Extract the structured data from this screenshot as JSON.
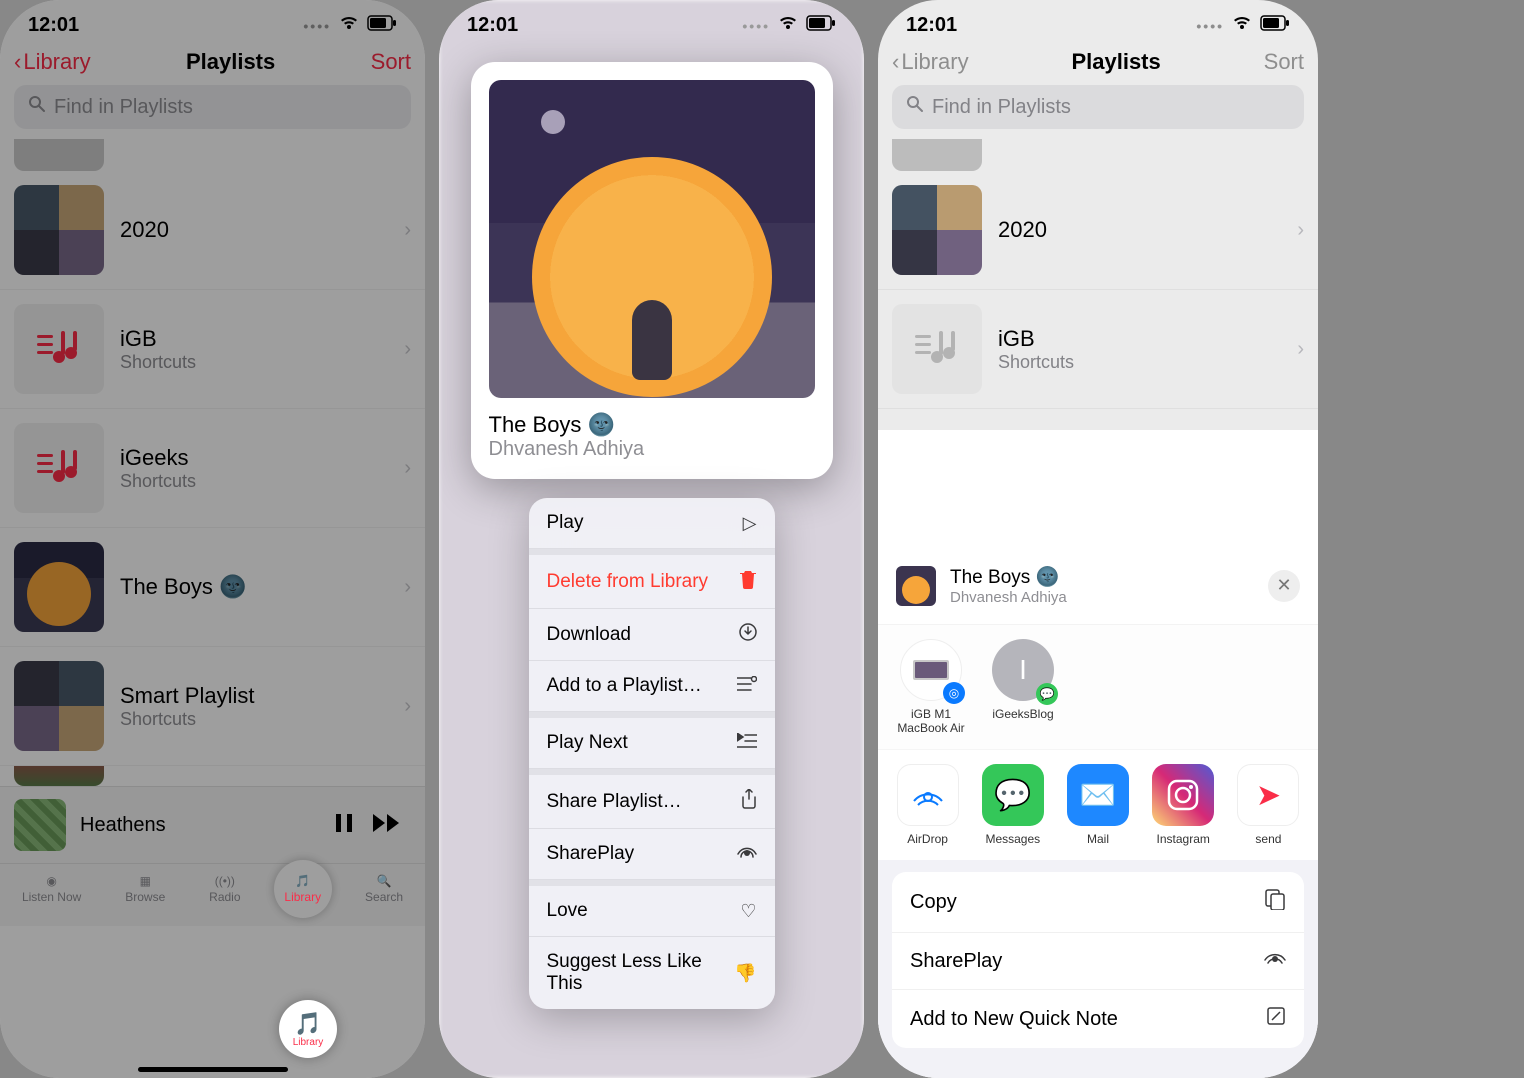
{
  "status": {
    "time": "12:01"
  },
  "nav": {
    "back_label": "Library",
    "title": "Playlists",
    "sort_label": "Sort"
  },
  "search": {
    "placeholder": "Find in Playlists"
  },
  "playlists": [
    {
      "title": "2020",
      "sub": ""
    },
    {
      "title": "iGB",
      "sub": "Shortcuts"
    },
    {
      "title": "iGeeks",
      "sub": "Shortcuts"
    },
    {
      "title": "The Boys 🌚",
      "sub": ""
    },
    {
      "title": "Smart Playlist",
      "sub": "Shortcuts"
    }
  ],
  "now_playing": {
    "title": "Heathens"
  },
  "tabs": {
    "listen": "Listen Now",
    "browse": "Browse",
    "radio": "Radio",
    "library": "Library",
    "search": "Search"
  },
  "context_card": {
    "title": "The Boys 🌚",
    "subtitle": "Dhvanesh Adhiya"
  },
  "context_menu": [
    {
      "label": "Play",
      "icon": "▷"
    },
    {
      "label": "Delete from Library",
      "icon": "trash",
      "destructive": true
    },
    {
      "label": "Download",
      "icon": "⤓"
    },
    {
      "label": "Add to a Playlist…",
      "icon": "≡+"
    },
    {
      "label": "Play Next",
      "icon": "≡▸"
    },
    {
      "label": "Share Playlist…",
      "icon": "⇧"
    },
    {
      "label": "SharePlay",
      "icon": "⦿"
    },
    {
      "label": "Love",
      "icon": "♡"
    },
    {
      "label": "Suggest Less Like This",
      "icon": "👎"
    }
  ],
  "share": {
    "item": {
      "title": "The Boys 🌚",
      "subtitle": "Dhvanesh Adhiya"
    },
    "contacts": [
      {
        "name": "iGB M1 MacBook Air",
        "badge": "airdrop"
      },
      {
        "name": "iGeeksBlog",
        "badge": "messages",
        "initial": "I"
      }
    ],
    "apps": [
      {
        "name": "AirDrop"
      },
      {
        "name": "Messages"
      },
      {
        "name": "Mail"
      },
      {
        "name": "Instagram"
      },
      {
        "name": "send"
      }
    ],
    "actions": [
      {
        "label": "Copy",
        "icon": "⧉"
      },
      {
        "label": "SharePlay",
        "icon": "⦿"
      },
      {
        "label": "Add to New Quick Note",
        "icon": "✎"
      }
    ]
  }
}
